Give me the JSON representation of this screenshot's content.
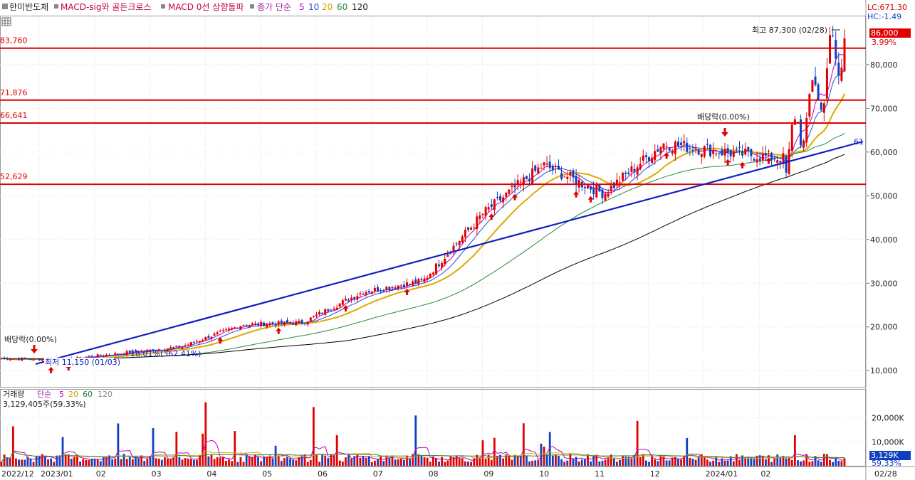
{
  "toolbar": {
    "items": [
      {
        "label": "한미반도체",
        "color": "#222222"
      },
      {
        "label": "MACD-sig와 골든크로스",
        "color": "#c00040"
      },
      {
        "label": "MACD 0선 상향돌파",
        "color": "#c00040"
      }
    ],
    "ma_prefix": "종가 단순",
    "ma_periods": [
      {
        "label": "5",
        "color": "#c000c0"
      },
      {
        "label": "10",
        "color": "#2050d0"
      },
      {
        "label": "20",
        "color": "#d0a000"
      },
      {
        "label": "60",
        "color": "#208040"
      },
      {
        "label": "120",
        "color": "#222222"
      }
    ]
  },
  "top_right": {
    "lc": "LC:671.30",
    "hc": "HC:-1.49"
  },
  "price_panel": {
    "y_axis_ticks": [
      "10,000",
      "20,000",
      "30,000",
      "40,000",
      "50,000",
      "60,000",
      "70,000",
      "80,000"
    ],
    "current_price": "86,000",
    "current_change": "3.99%",
    "high_annotation": "최고 87,300 (02/28)",
    "low_annotation": "최저 11,150 (01/03)",
    "gain_annotation": "18.01%(362.41%)",
    "dividend_labels": [
      "배당락(0.00%)",
      "배당락(0.00%)"
    ],
    "trendline_label": "61",
    "horizontal_levels": [
      "83,760",
      "71,876",
      "66,641",
      "52,629"
    ]
  },
  "volume_panel": {
    "legend_prefix": "거래량",
    "legend_ma_prefix": "단순",
    "legend_ma_periods": [
      {
        "label": "5",
        "color": "#c000c0"
      },
      {
        "label": "20",
        "color": "#d0a000"
      },
      {
        "label": "60",
        "color": "#208040"
      },
      {
        "label": "120",
        "color": "#888888"
      }
    ],
    "volume_info": "3,129,405주(59.33%)",
    "y_axis_ticks": [
      "10,000K",
      "20,000K"
    ],
    "current_volume": "3,129K",
    "current_volume_pct": "59.33%"
  },
  "x_axis": {
    "labels": [
      "2022/12",
      "2023/01",
      "02",
      "03",
      "04",
      "05",
      "06",
      "07",
      "08",
      "09",
      "10",
      "11",
      "12",
      "2024/01",
      "02"
    ],
    "end_label": "02/28"
  },
  "colors": {
    "up": "#e00000",
    "down": "#1040c0",
    "ma5": "#c000c0",
    "ma10": "#2050d0",
    "ma20": "#e0a800",
    "ma60": "#2a8a3a",
    "ma120": "#000000",
    "trendline": "#1020c0",
    "level": "#e00000"
  },
  "chart_data": {
    "type": "candlestick",
    "title": "한미반도체",
    "x": [
      "2022-12",
      "2023-01",
      "2023-02",
      "2023-03",
      "2023-04",
      "2023-05",
      "2023-06",
      "2023-07",
      "2023-08",
      "2023-09",
      "2023-10",
      "2023-11",
      "2023-12",
      "2024-01",
      "2024-02-28"
    ],
    "close_approx": [
      12800,
      12500,
      14000,
      15500,
      20500,
      21000,
      28000,
      30500,
      46000,
      57000,
      50500,
      62000,
      60000,
      58500,
      86000
    ],
    "price_ylim": [
      5000,
      90000
    ],
    "high": {
      "value": 87300,
      "date": "02/28"
    },
    "low": {
      "value": 11150,
      "date": "01/03"
    },
    "horizontal_levels": [
      83760,
      71876,
      66641,
      52629
    ],
    "current_price": 86000,
    "volume_ylim": [
      0,
      27000
    ],
    "current_volume_k": 3129
  }
}
